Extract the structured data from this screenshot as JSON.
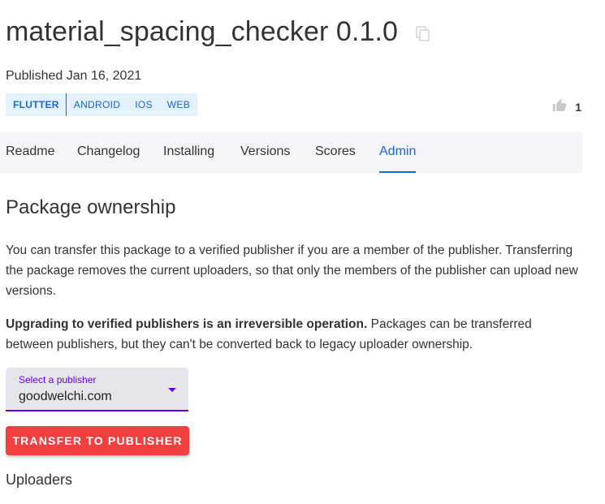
{
  "package": {
    "title": "material_spacing_checker 0.1.0",
    "published": "Published Jan 16, 2021",
    "platforms": [
      "FLUTTER",
      "ANDROID",
      "IOS",
      "WEB"
    ],
    "likes": "1",
    "copy_icon": "copy-icon",
    "like_icon": "thumb-up-icon"
  },
  "tabs": [
    {
      "label": "Readme"
    },
    {
      "label": "Changelog"
    },
    {
      "label": "Installing"
    },
    {
      "label": "Versions"
    },
    {
      "label": "Scores"
    },
    {
      "label": "Admin",
      "active": true
    }
  ],
  "ownership": {
    "heading": "Package ownership",
    "paragraph1": "You can transfer this package to a verified publisher if you are a member of the publisher. Transferring the package removes the current uploaders, so that only the members of the publisher can upload new versions.",
    "paragraph2_bold": "Upgrading to verified publishers is an irreversible operation.",
    "paragraph2_rest": " Packages can be transferred between publishers, but they can't be converted back to legacy uploader ownership.",
    "select_label": "Select a publisher",
    "select_value": "goodwelchi.com",
    "transfer_button": "TRANSFER TO PUBLISHER"
  },
  "uploaders": {
    "heading": "Uploaders"
  },
  "colors": {
    "accent": "#1967d2",
    "tag_bg": "#e3f2fd",
    "select_accent": "#6200ee",
    "button_red": "#f24041"
  }
}
